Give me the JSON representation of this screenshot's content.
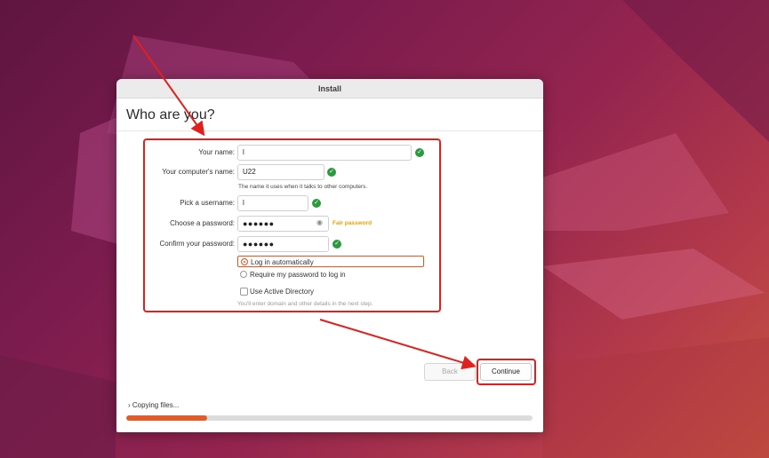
{
  "window": {
    "title": "Install"
  },
  "page": {
    "heading": "Who are you?"
  },
  "form": {
    "name": {
      "label": "Your name:",
      "value": "l"
    },
    "computer_name": {
      "label": "Your computer's name:",
      "value": "U22",
      "hint": "The name it uses when it talks to other computers."
    },
    "username": {
      "label": "Pick a username:",
      "value": "l"
    },
    "password": {
      "label": "Choose a password:",
      "value": "●●●●●●",
      "strength": "Fair password"
    },
    "confirm_password": {
      "label": "Confirm your password:",
      "value": "●●●●●●"
    },
    "login_options": [
      {
        "label": "Log in automatically",
        "selected": true
      },
      {
        "label": "Require my password to log in",
        "selected": false
      }
    ],
    "active_directory": {
      "label": "Use Active Directory",
      "checked": false,
      "hint": "You'll enter domain and other details in the next step."
    }
  },
  "buttons": {
    "back": "Back",
    "continue": "Continue"
  },
  "progress": {
    "label": "Copying files...",
    "percent": 20
  },
  "colors": {
    "accent": "#e95420",
    "check": "#2b9a3e",
    "annotation": "#e0201c",
    "strength": "#e8a100"
  }
}
